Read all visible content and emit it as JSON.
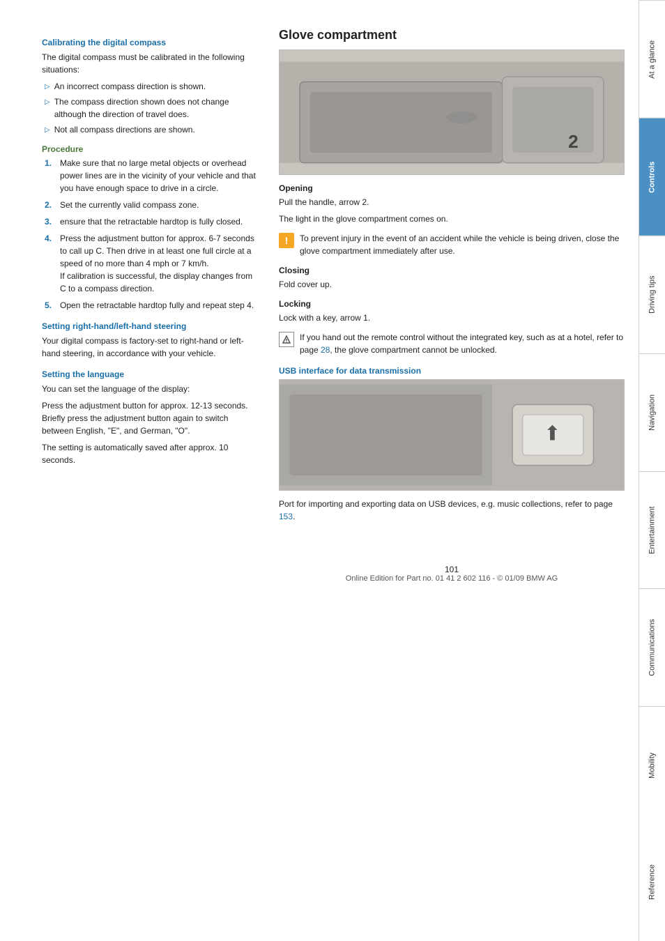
{
  "page": {
    "number": "101",
    "footer_text": "Online Edition for Part no. 01 41 2 602 116 - © 01/09 BMW AG"
  },
  "left": {
    "calibrating_heading": "Calibrating the digital compass",
    "calibrating_intro": "The digital compass must be calibrated in the following situations:",
    "calibrating_bullets": [
      "An incorrect compass direction is shown.",
      "The compass direction shown does not change although the direction of travel does.",
      "Not all compass directions are shown."
    ],
    "procedure_heading": "Procedure",
    "procedure_steps": [
      "Make sure that no large metal objects or overhead power lines are in the vicinity of your vehicle and that you have enough space to drive in a circle.",
      "Set the currently valid compass zone.",
      "ensure that the retractable hardtop is fully closed.",
      "Press the adjustment button for approx. 6-7 seconds to call up C. Then drive in at least one full circle at a speed of no more than 4 mph or 7 km/h.\nIf calibration is successful, the display changes from C to a compass direction.",
      "Open the retractable hardtop fully and repeat step 4."
    ],
    "steering_heading": "Setting right-hand/left-hand steering",
    "steering_text": "Your digital compass is factory-set to right-hand or left-hand steering, in accordance with your vehicle.",
    "language_heading": "Setting the language",
    "language_text1": "You can set the language of the display:",
    "language_text2": "Press the adjustment button for approx. 12-13 seconds. Briefly press the adjustment button again to switch between English, \"E\", and German, \"O\".",
    "language_text3": "The setting is automatically saved after approx. 10 seconds."
  },
  "right": {
    "glove_heading": "Glove compartment",
    "glove_image_alt": "Glove compartment photo",
    "glove_number": "2",
    "glove_image_id": "TY101/003",
    "opening_heading": "Opening",
    "opening_text1": "Pull the handle, arrow 2.",
    "opening_text2": "The light in the glove compartment comes on.",
    "opening_warning": "To prevent injury in the event of an accident while the vehicle is being driven, close the glove compartment immediately after use.",
    "closing_heading": "Closing",
    "closing_text": "Fold cover up.",
    "locking_heading": "Locking",
    "locking_text": "Lock with a key, arrow 1.",
    "locking_note": "If you hand out the remote control without the integrated key, such as at a hotel, refer to page 28, the glove compartment cannot be unlocked.",
    "locking_note_page": "28",
    "usb_heading": "USB interface for data transmission",
    "usb_image_alt": "USB interface photo",
    "usb_image_id": "TY101H/094",
    "usb_text": "Port for importing and exporting data on USB devices, e.g. music collections, refer to page 153.",
    "usb_page": "153"
  },
  "sidebar": {
    "sections": [
      {
        "id": "at-a-glance",
        "label": "At a glance",
        "active": false
      },
      {
        "id": "controls",
        "label": "Controls",
        "active": true
      },
      {
        "id": "driving-tips",
        "label": "Driving tips",
        "active": false
      },
      {
        "id": "navigation",
        "label": "Navigation",
        "active": false
      },
      {
        "id": "entertainment",
        "label": "Entertainment",
        "active": false
      },
      {
        "id": "communications",
        "label": "Communications",
        "active": false
      },
      {
        "id": "mobility",
        "label": "Mobility",
        "active": false
      },
      {
        "id": "reference",
        "label": "Reference",
        "active": false
      }
    ]
  }
}
